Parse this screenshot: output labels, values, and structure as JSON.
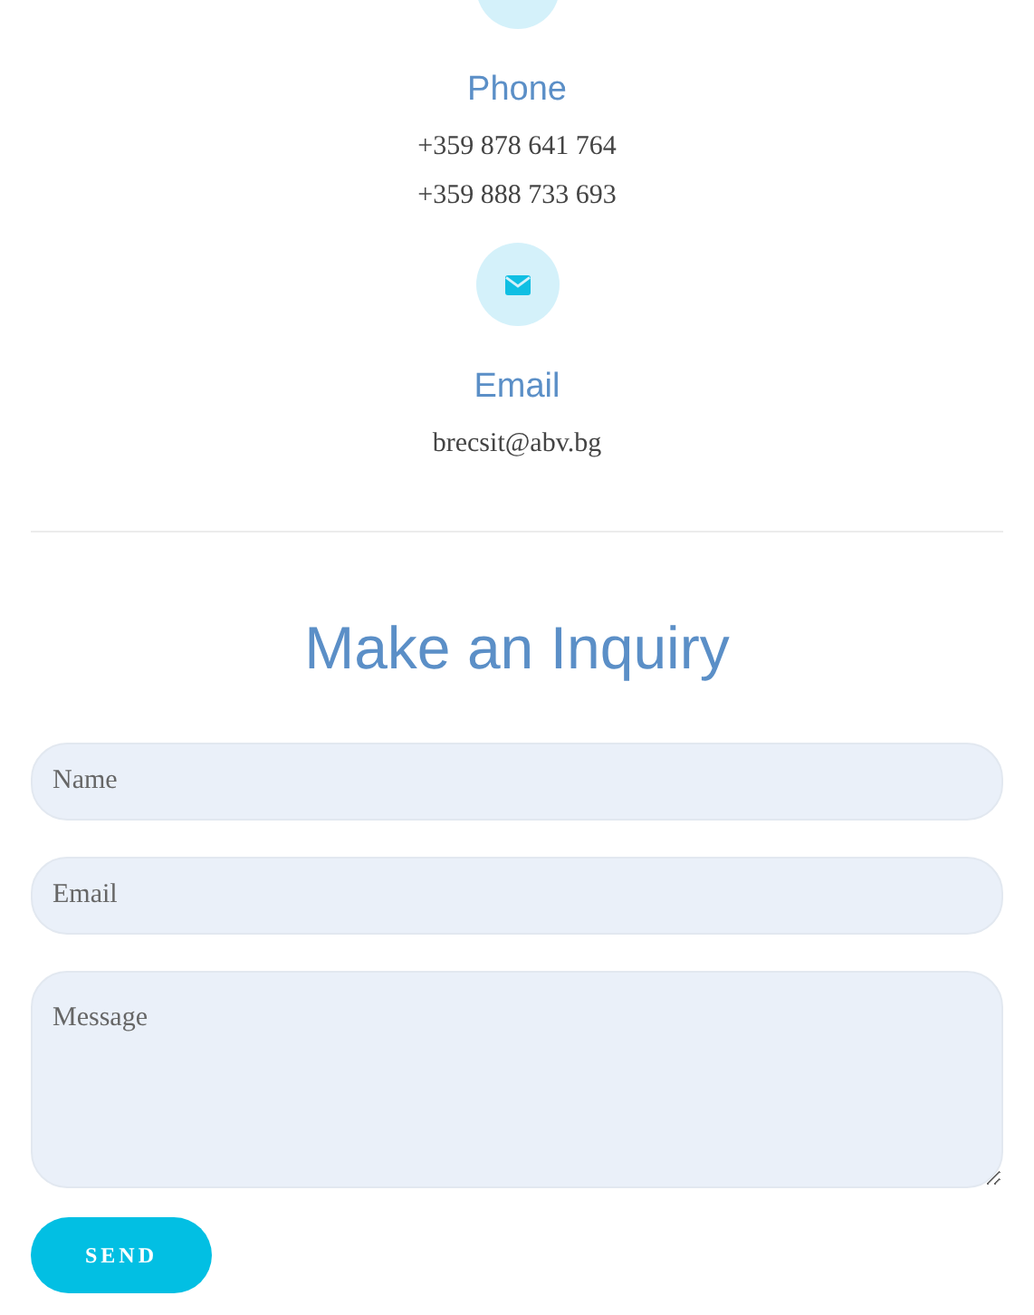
{
  "contacts": [
    {
      "kind": "phone",
      "title": "Phone",
      "lines": [
        "+359 878 641 764",
        "+359 888 733 693"
      ]
    },
    {
      "kind": "email",
      "title": "Email",
      "lines": [
        "brecsit@abv.bg"
      ]
    }
  ],
  "form": {
    "heading": "Make an Inquiry",
    "fields": [
      {
        "kind": "input",
        "placeholder": "Name"
      },
      {
        "kind": "input",
        "placeholder": "Email"
      },
      {
        "kind": "textarea",
        "placeholder": "Message"
      }
    ],
    "button": "SEND"
  }
}
